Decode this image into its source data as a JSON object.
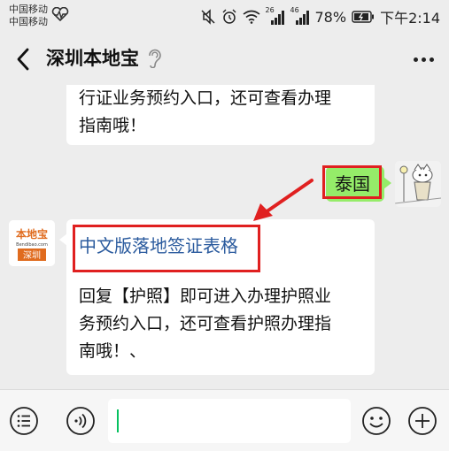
{
  "status_bar": {
    "carrier_1": "中国移动",
    "carrier_2": "中国移动",
    "battery_percent": "78%",
    "time": "下午2:14",
    "network_1": "26",
    "network_2": "46"
  },
  "header": {
    "title": "深圳本地宝"
  },
  "messages": {
    "m1_line1": "行证业务预约入口，还可查看办理",
    "m1_line2": "指南哦！",
    "user_reply": "泰国",
    "bot_link": "中文版落地签证表格",
    "m2_line1": "回复【护照】即可进入办理护照业",
    "m2_line2": "务预约入口，还可查看护照办理指",
    "m2_line3": "南哦！、"
  },
  "bot_avatar": {
    "brand": "本地宝",
    "site": "Bendibao.com",
    "city": "深圳"
  },
  "colors": {
    "accent_green": "#95ec69",
    "highlight_red": "#e02020",
    "link_blue": "#2b5b9e"
  },
  "icons": [
    "back-icon",
    "ear-icon",
    "more-icon",
    "menu-list-icon",
    "voice-icon",
    "emoji-icon",
    "plus-icon"
  ]
}
